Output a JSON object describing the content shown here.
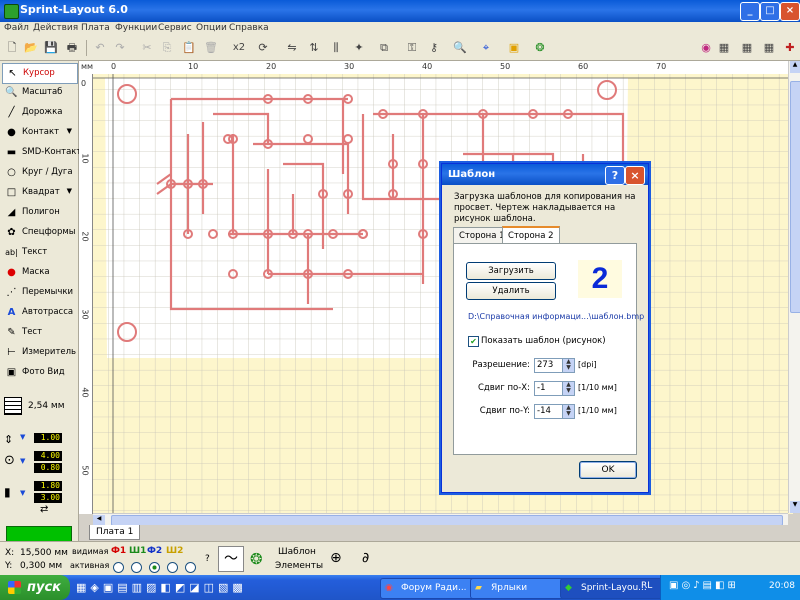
{
  "window": {
    "title": "Sprint-Layout 6.0"
  },
  "menu": [
    "Файл",
    "Действия",
    "Плата",
    "Функции",
    "Сервис",
    "Опции",
    "Справка"
  ],
  "toolbar": {
    "zoom_x2": "x2"
  },
  "tools": [
    {
      "label": "Курсор",
      "icon": "cursor-icon",
      "selected": true
    },
    {
      "label": "Масштаб",
      "icon": "magnifier-icon"
    },
    {
      "label": "Дорожка",
      "icon": "track-icon"
    },
    {
      "label": "Контакт",
      "icon": "pad-icon",
      "submenu": true
    },
    {
      "label": "SMD-Контакт",
      "icon": "smd-pad-icon"
    },
    {
      "label": "Круг / Дуга",
      "icon": "circle-icon"
    },
    {
      "label": "Квадрат",
      "icon": "square-icon",
      "submenu": true
    },
    {
      "label": "Полигон",
      "icon": "polygon-icon"
    },
    {
      "label": "Спецформы",
      "icon": "special-shapes-icon"
    },
    {
      "label": "Текст",
      "icon": "text-icon"
    },
    {
      "label": "Маска",
      "icon": "mask-icon"
    },
    {
      "label": "Перемычки",
      "icon": "jumper-icon"
    },
    {
      "label": "Автотрасса",
      "icon": "autoroute-icon"
    },
    {
      "label": "Тест",
      "icon": "test-icon"
    },
    {
      "label": "Измеритель",
      "icon": "ruler-icon"
    },
    {
      "label": "Фото Вид",
      "icon": "photo-view-icon"
    }
  ],
  "grid": {
    "size": "2,54 мм"
  },
  "params": {
    "track_width": "1.00",
    "pad_outer": "4.00",
    "pad_inner": "0.80",
    "smd_w": "1.80",
    "smd_h": "3.00"
  },
  "ruler": {
    "unit": "мм",
    "top_labels": [
      "0",
      "10",
      "20",
      "30",
      "40",
      "50",
      "60",
      "70"
    ],
    "left_labels": [
      "0",
      "10",
      "20",
      "30",
      "40",
      "50"
    ]
  },
  "board_tab": "Плата 1",
  "status": {
    "x_label": "X:",
    "x_value": "15,500 мм",
    "y_label": "Y:",
    "y_value": "0,300 мм",
    "visible_label": "видимая",
    "active_label": "активная",
    "layers": [
      {
        "name": "Ф1",
        "color": "#d40000"
      },
      {
        "name": "Ш1",
        "color": "#1a8a1a"
      },
      {
        "name": "Ф2",
        "color": "#1030c8"
      },
      {
        "name": "Ш2",
        "color": "#c8a000"
      }
    ],
    "help": "?",
    "template_label": "Шаблон",
    "elements_label": "Элементы"
  },
  "dialog": {
    "title": "Шаблон",
    "help_btn": "?",
    "description": "Загрузка шаблонов для копирования на просвет. Чертеж накладывается на рисунок шаблона.",
    "tabs": [
      "Сторона 1",
      "Сторона 2"
    ],
    "active_tab": 1,
    "load_btn": "Загрузить",
    "delete_btn": "Удалить",
    "side_number": "2",
    "path": "D:\\Справочная информаци...\\шаблон.bmp",
    "show_template": "Показать шаблон (рисунок)",
    "resolution": {
      "label": "Разрешение:",
      "value": "273",
      "unit": "[dpi]"
    },
    "shift_x": {
      "label": "Сдвиг по-X:",
      "value": "-1",
      "unit": "[1/10 мм]"
    },
    "shift_y": {
      "label": "Сдвиг по-Y:",
      "value": "-14",
      "unit": "[1/10 мм]"
    },
    "ok": "OK"
  },
  "taskbar": {
    "start": "пуск",
    "tasks": [
      "Форум Ради...",
      "Ярлыки",
      "Sprint-Layou..."
    ],
    "lang": "RL",
    "clock": "20:08"
  }
}
